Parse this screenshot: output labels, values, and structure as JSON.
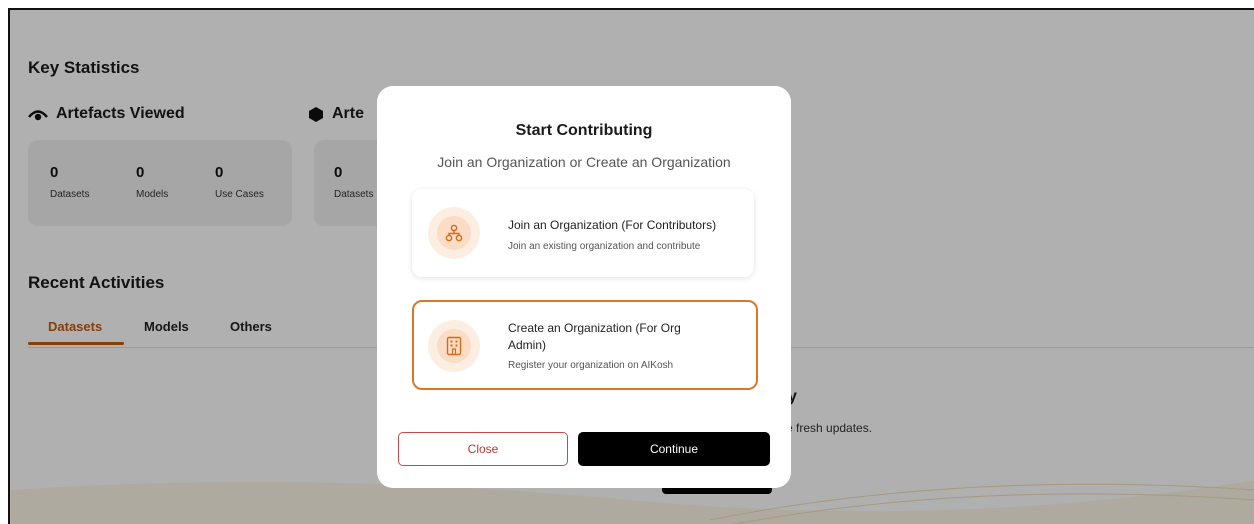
{
  "page": {
    "key_stats_title": "Key Statistics",
    "artefacts_viewed": {
      "title": "Artefacts Viewed",
      "stats": [
        {
          "value": "0",
          "label": "Datasets"
        },
        {
          "value": "0",
          "label": "Models"
        },
        {
          "value": "0",
          "label": "Use Cases"
        }
      ]
    },
    "second_section": {
      "title_partial": "Arte",
      "stats": [
        {
          "value": "0",
          "label": "Datasets"
        }
      ]
    },
    "recent_activities_title": "Recent Activities",
    "tabs": [
      {
        "label": "Datasets",
        "active": true
      },
      {
        "label": "Models",
        "active": false
      },
      {
        "label": "Others",
        "active": false
      }
    ],
    "empty_title_partial": "y",
    "empty_desc_partial": "e fresh updates."
  },
  "modal": {
    "title": "Start Contributing",
    "subtitle": "Join an Organization or Create an Organization",
    "options": [
      {
        "title": "Join an Organization (For Contributors)",
        "description": "Join an existing organization and contribute",
        "icon": "org-hierarchy-icon",
        "selected": false
      },
      {
        "title": "Create an Organization (For Org Admin)",
        "description": "Register your organization on AIKosh",
        "icon": "building-icon",
        "selected": true
      }
    ],
    "close_label": "Close",
    "continue_label": "Continue"
  },
  "colors": {
    "accent": "#c45a0d",
    "selected_border": "#d9782b",
    "overlay": "rgba(0,0,0,0.31)",
    "primary_button": "#000000"
  }
}
